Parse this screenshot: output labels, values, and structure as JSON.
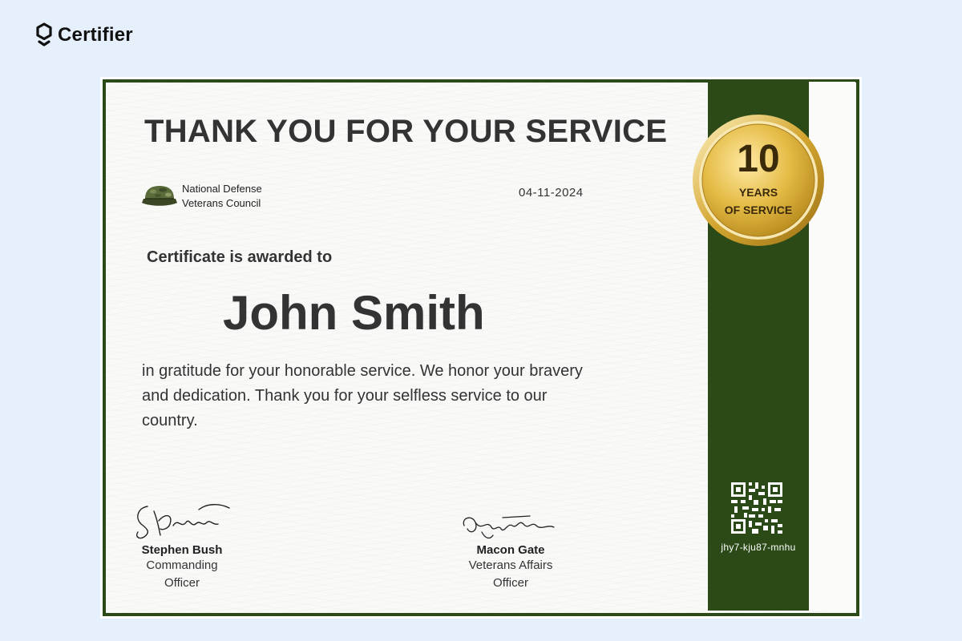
{
  "brand": {
    "name": "Certifier",
    "logo_icon": "certifier-logo-icon"
  },
  "certificate": {
    "title": "THANK YOU FOR YOUR SERVICE",
    "organization": {
      "line1": "National Defense",
      "line2": "Veterans Council",
      "logo_icon": "military-cap-icon"
    },
    "date": "04-11-2024",
    "awarded_text": "Certificate is awarded to",
    "recipient_name": "John Smith",
    "message": "in gratitude for your honorable service. We honor your bravery and dedication. Thank you for your selfless service to our country.",
    "seal": {
      "number": "10",
      "line1": "YEARS",
      "line2": "OF SERVICE"
    },
    "signatories": [
      {
        "name": "Stephen Bush",
        "role_line1": "Commanding",
        "role_line2": "Officer"
      },
      {
        "name": "Macon Gate",
        "role_line1": "Veterans Affairs",
        "role_line2": "Officer"
      }
    ],
    "verification_code": "jhy7-kju87-mnhu",
    "colors": {
      "ribbon": "#2b4a17",
      "background": "#e6f0fd",
      "gold": "#e2b93b",
      "text": "#333333"
    }
  }
}
